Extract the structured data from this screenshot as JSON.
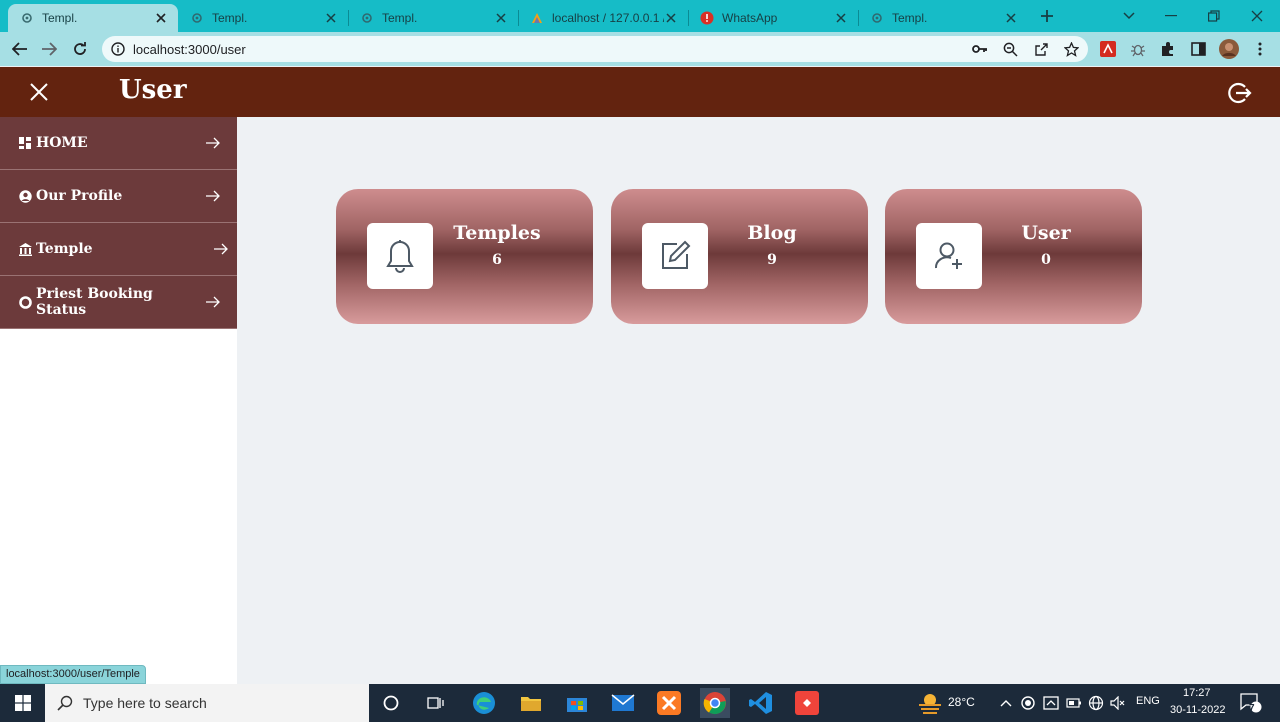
{
  "browser": {
    "tabs": [
      {
        "title": "Templ.",
        "active": true,
        "favicon": "gear-icon"
      },
      {
        "title": "Templ.",
        "active": false,
        "favicon": "gear-icon"
      },
      {
        "title": "Templ.",
        "active": false,
        "favicon": "gear-icon"
      },
      {
        "title": "localhost / 127.0.0.1 /",
        "active": false,
        "favicon": "phpmyadmin-icon"
      },
      {
        "title": "WhatsApp",
        "active": false,
        "favicon": "alert-icon"
      },
      {
        "title": "Templ.",
        "active": false,
        "favicon": "gear-icon"
      }
    ],
    "url": "localhost:3000/user",
    "status_url": "localhost:3000/user/Temple"
  },
  "header": {
    "title": "User"
  },
  "sidebar": {
    "items": [
      {
        "label": "HOME",
        "icon": "dashboard-icon"
      },
      {
        "label": "Our Profile",
        "icon": "user-circle-icon"
      },
      {
        "label": "Temple",
        "icon": "temple-icon"
      },
      {
        "label": "Priest Booking Status",
        "icon": "circle-icon"
      }
    ]
  },
  "cards": [
    {
      "title": "Temples",
      "value": "6",
      "icon": "bell-icon"
    },
    {
      "title": "Blog",
      "value": "9",
      "icon": "edit-icon"
    },
    {
      "title": "User",
      "value": "0",
      "icon": "add-user-icon"
    }
  ],
  "colors": {
    "header": "#63230f",
    "sidebar": "#6c3a3b",
    "tabbar": "#16bcc7"
  },
  "taskbar": {
    "search_placeholder": "Type here to search",
    "weather": "28°C",
    "language": "ENG",
    "time": "17:27",
    "date": "30-11-2022",
    "notifications": "7"
  }
}
